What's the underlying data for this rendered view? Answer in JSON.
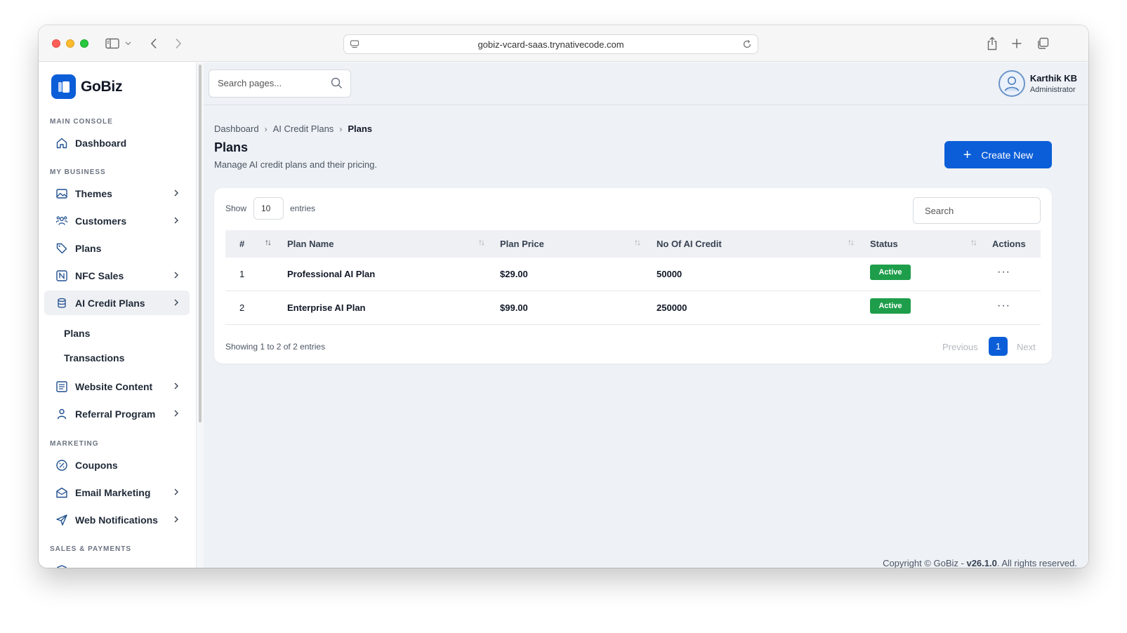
{
  "browser": {
    "url": "gobiz-vcard-saas.trynativecode.com"
  },
  "sidebar": {
    "logo_text": "GoBiz",
    "sections": {
      "main_console": "MAIN CONSOLE",
      "my_business": "MY BUSINESS",
      "marketing": "MARKETING",
      "sales_payments": "SALES & PAYMENTS"
    },
    "items": {
      "dashboard": "Dashboard",
      "themes": "Themes",
      "customers": "Customers",
      "plans": "Plans",
      "nfc_sales": "NFC Sales",
      "ai_credit_plans": "AI Credit Plans",
      "sub_plans": "Plans",
      "sub_transactions": "Transactions",
      "website_content": "Website Content",
      "referral_program": "Referral Program",
      "coupons": "Coupons",
      "email_marketing": "Email Marketing",
      "web_notifications": "Web Notifications"
    }
  },
  "topbar": {
    "search_placeholder": "Search pages...",
    "user_name": "Karthik KB",
    "user_role": "Administrator"
  },
  "breadcrumb": [
    "Dashboard",
    "AI Credit Plans",
    "Plans"
  ],
  "page": {
    "title": "Plans",
    "subtitle": "Manage AI credit plans and their pricing.",
    "create_label": "Create New"
  },
  "table": {
    "show_label": "Show",
    "page_size": "10",
    "entries_label": "entries",
    "search_placeholder": "Search",
    "columns": [
      "#",
      "Plan Name",
      "Plan Price",
      "No Of AI Credit",
      "Status",
      "Actions"
    ],
    "rows": [
      {
        "num": "1",
        "name": "Professional AI Plan",
        "price": "$29.00",
        "credits": "50000",
        "status": "Active"
      },
      {
        "num": "2",
        "name": "Enterprise AI Plan",
        "price": "$99.00",
        "credits": "250000",
        "status": "Active"
      }
    ],
    "info": "Showing 1 to 2 of 2 entries",
    "pagination": {
      "previous": "Previous",
      "current": "1",
      "next": "Next"
    }
  },
  "footer": {
    "prefix": "Copyright © GoBiz - ",
    "version": "v26.1.0",
    "suffix": ". All rights reserved."
  },
  "colors": {
    "primary": "#0b5ed7",
    "active_badge": "#1e9e4a",
    "main_bg": "#eef1f5"
  }
}
